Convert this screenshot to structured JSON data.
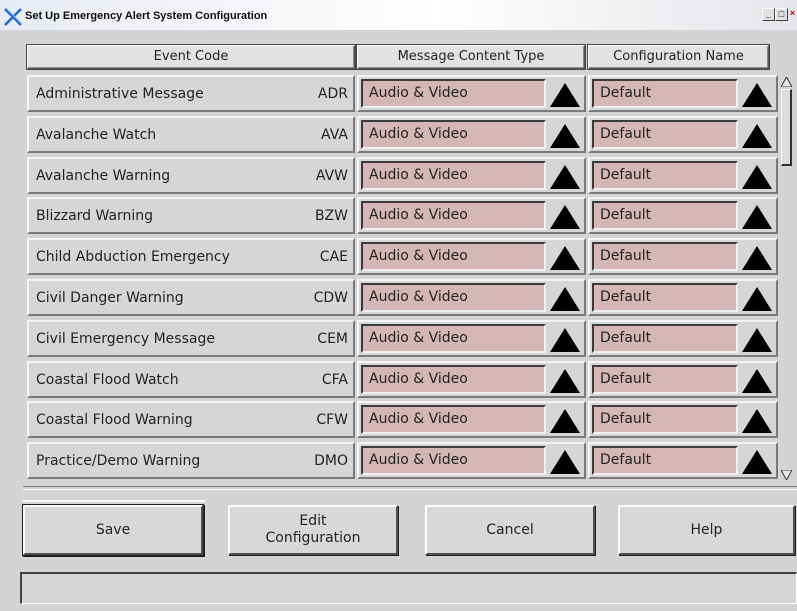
{
  "window": {
    "title": "Set Up Emergency Alert System Configuration",
    "minimize_label": "_",
    "maximize_label": "□",
    "close_label": "×"
  },
  "table": {
    "headers": {
      "event": "Event Code",
      "content": "Message Content Type",
      "config": "Configuration Name"
    },
    "rows": [
      {
        "name": "Administrative Message",
        "code": "ADR",
        "content": "Audio & Video",
        "config": "Default"
      },
      {
        "name": "Avalanche Watch",
        "code": "AVA",
        "content": "Audio & Video",
        "config": "Default"
      },
      {
        "name": "Avalanche Warning",
        "code": "AVW",
        "content": "Audio & Video",
        "config": "Default"
      },
      {
        "name": "Blizzard Warning",
        "code": "BZW",
        "content": "Audio & Video",
        "config": "Default"
      },
      {
        "name": "Child Abduction Emergency",
        "code": "CAE",
        "content": "Audio & Video",
        "config": "Default"
      },
      {
        "name": "Civil Danger Warning",
        "code": "CDW",
        "content": "Audio & Video",
        "config": "Default"
      },
      {
        "name": "Civil Emergency Message",
        "code": "CEM",
        "content": "Audio & Video",
        "config": "Default"
      },
      {
        "name": "Coastal Flood Watch",
        "code": "CFA",
        "content": "Audio & Video",
        "config": "Default"
      },
      {
        "name": "Coastal Flood Warning",
        "code": "CFW",
        "content": "Audio & Video",
        "config": "Default"
      },
      {
        "name": "Practice/Demo Warning",
        "code": "DMO",
        "content": "Audio & Video",
        "config": "Default"
      }
    ]
  },
  "buttons": {
    "save": "Save",
    "edit_line1": "Edit",
    "edit_line2": "Configuration",
    "cancel": "Cancel",
    "help": "Help"
  },
  "status": {
    "text": ""
  },
  "colors": {
    "field_bg": "#d4b6b6",
    "panel_bg": "#d4d4d4"
  },
  "icons": {
    "app": "eas-x-icon",
    "dropdown": "triangle-up-icon",
    "scroll_up": "scroll-up-arrow-icon",
    "scroll_down": "scroll-down-arrow-icon"
  }
}
